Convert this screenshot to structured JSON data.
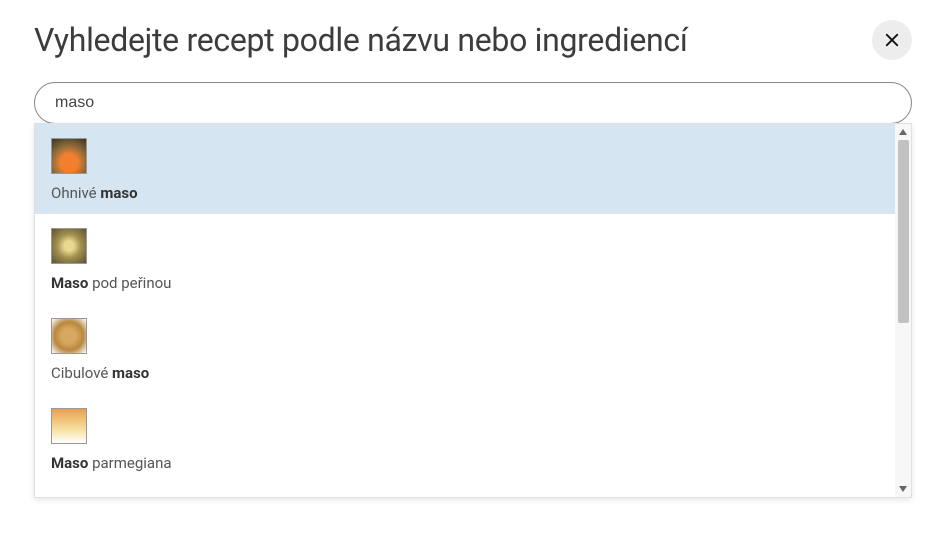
{
  "header": {
    "title": "Vyhledejte recept podle názvu nebo ingrediencí"
  },
  "search": {
    "value": "maso",
    "placeholder": ""
  },
  "results": [
    {
      "pre": "Ohnivé ",
      "match": "maso",
      "post": "",
      "highlighted": true
    },
    {
      "pre": "",
      "match": "Maso",
      "post": " pod peřinou",
      "highlighted": false
    },
    {
      "pre": "Cibulové ",
      "match": "maso",
      "post": "",
      "highlighted": false
    },
    {
      "pre": "",
      "match": "Maso",
      "post": " parmegiana",
      "highlighted": false
    },
    {
      "pre": "",
      "match": "",
      "post": "",
      "highlighted": false
    }
  ]
}
